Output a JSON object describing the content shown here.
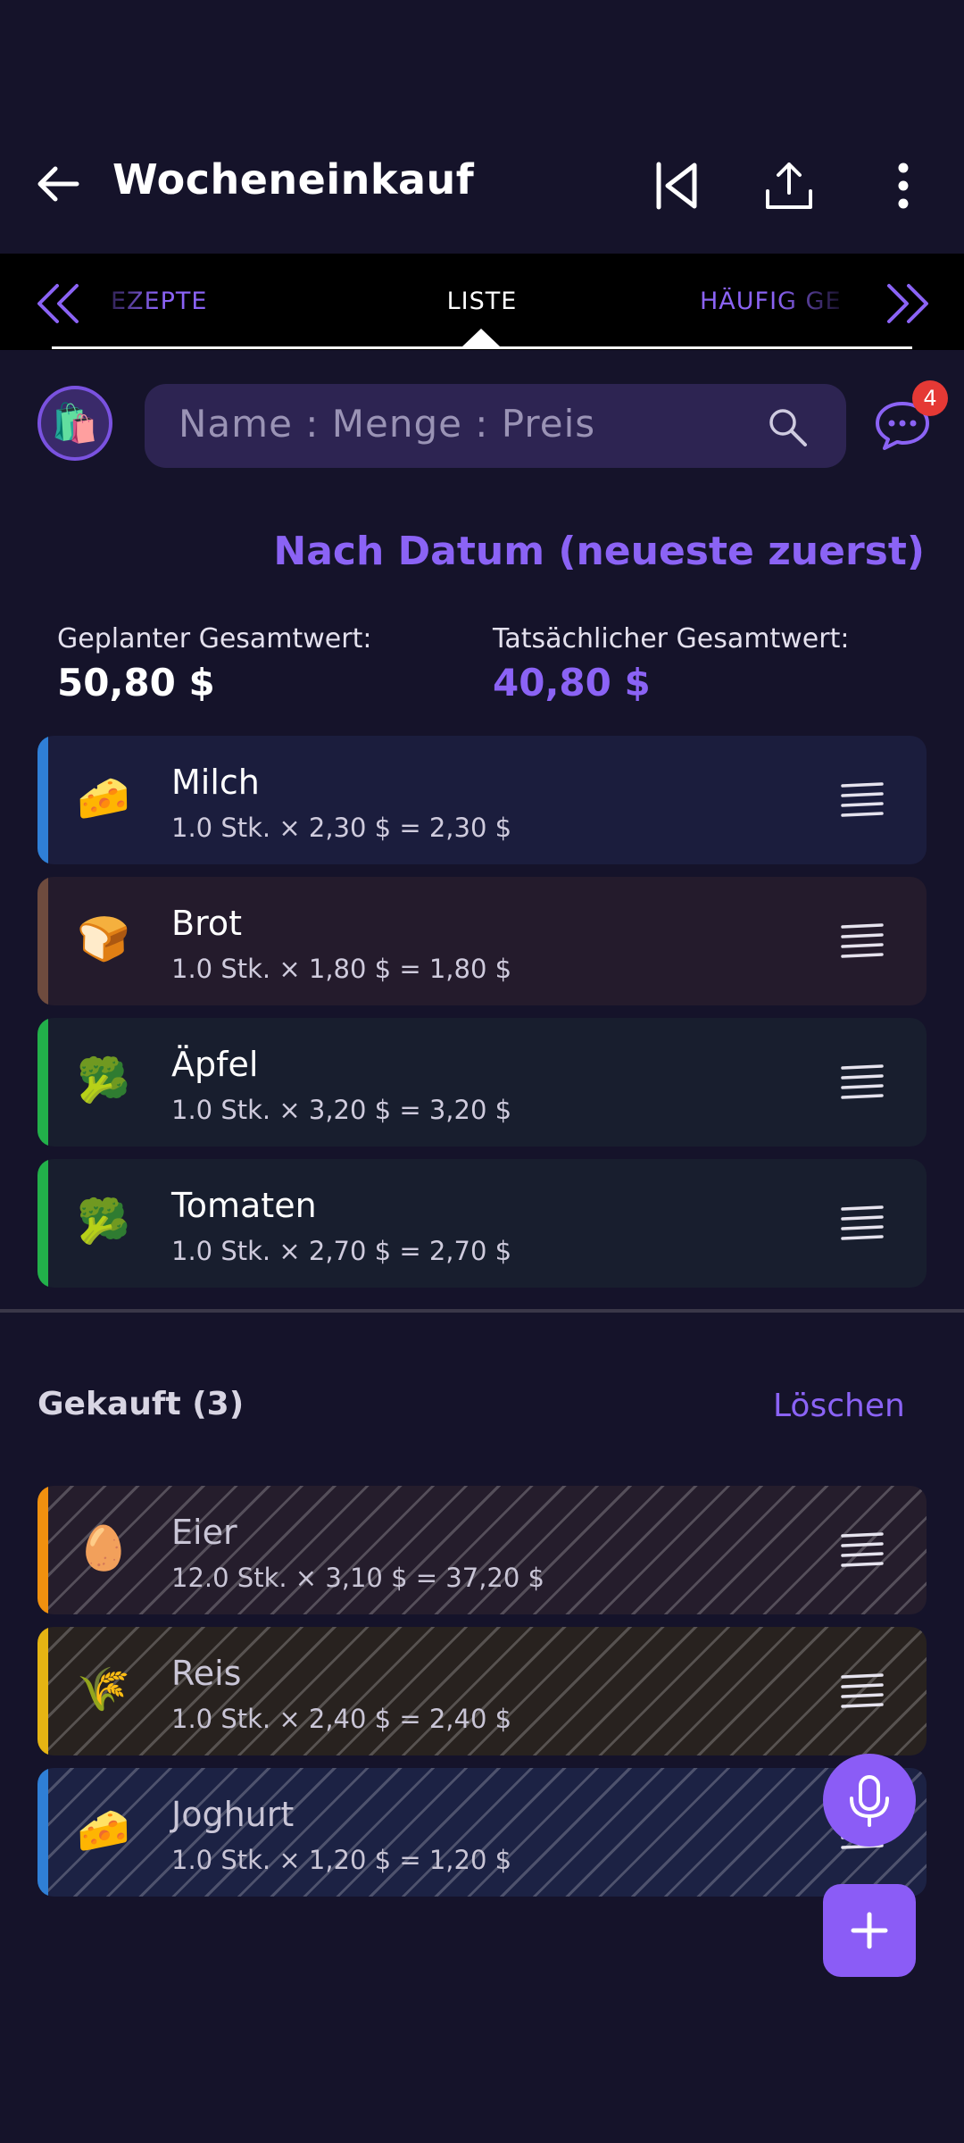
{
  "header": {
    "title": "Wocheneinkauf"
  },
  "tabs": {
    "left": "EZEPTE",
    "center": "LISTE",
    "right": "HÄUFIG GE"
  },
  "search": {
    "placeholder": "Name : Menge : Preis"
  },
  "chat_badge": "4",
  "sort_label": "Nach Datum (neueste zuerst)",
  "totals": {
    "planned_label": "Geplanter Gesamtwert:",
    "planned_value": "50,80 $",
    "actual_label": "Tatsächlicher Gesamtwert:",
    "actual_value": "40,80 $"
  },
  "items": [
    {
      "icon": "🧀",
      "name": "Milch",
      "detail": "1.0 Stk. × 2,30 $ = 2,30 $"
    },
    {
      "icon": "🍞",
      "name": "Brot",
      "detail": "1.0 Stk. × 1,80 $ = 1,80 $"
    },
    {
      "icon": "🥦",
      "name": "Äpfel",
      "detail": "1.0 Stk. × 3,20 $ = 3,20 $"
    },
    {
      "icon": "🥦",
      "name": "Tomaten",
      "detail": "1.0 Stk. × 2,70 $ = 2,70 $"
    }
  ],
  "bought": {
    "title": "Gekauft (3)",
    "clear_label": "Löschen",
    "items": [
      {
        "icon": "🥚",
        "name": "Eier",
        "detail": "12.0 Stk. × 3,10 $ = 37,20 $"
      },
      {
        "icon": "🌾",
        "name": "Reis",
        "detail": "1.0 Stk. × 2,40 $ = 2,40 $"
      },
      {
        "icon": "🧀",
        "name": "Joghurt",
        "detail": "1.0 Stk. × 1,20 $ = 1,20 $"
      }
    ]
  },
  "icons": {
    "bag": "🛍️",
    "back": "arrow-left-icon",
    "first_page": "skip-to-start-icon",
    "share": "share-icon",
    "more": "more-vertical-icon",
    "search": "search-icon",
    "chat": "chat-icon",
    "mic": "microphone-icon",
    "add": "plus-icon"
  },
  "colors": {
    "accent": "#8b5cf6",
    "background": "#15132a",
    "stripe_blue": "#2f7fd6",
    "stripe_brown": "#6e4b3e",
    "stripe_green": "#22b04a",
    "stripe_orange": "#f0900f",
    "stripe_yellow": "#e5b413"
  }
}
